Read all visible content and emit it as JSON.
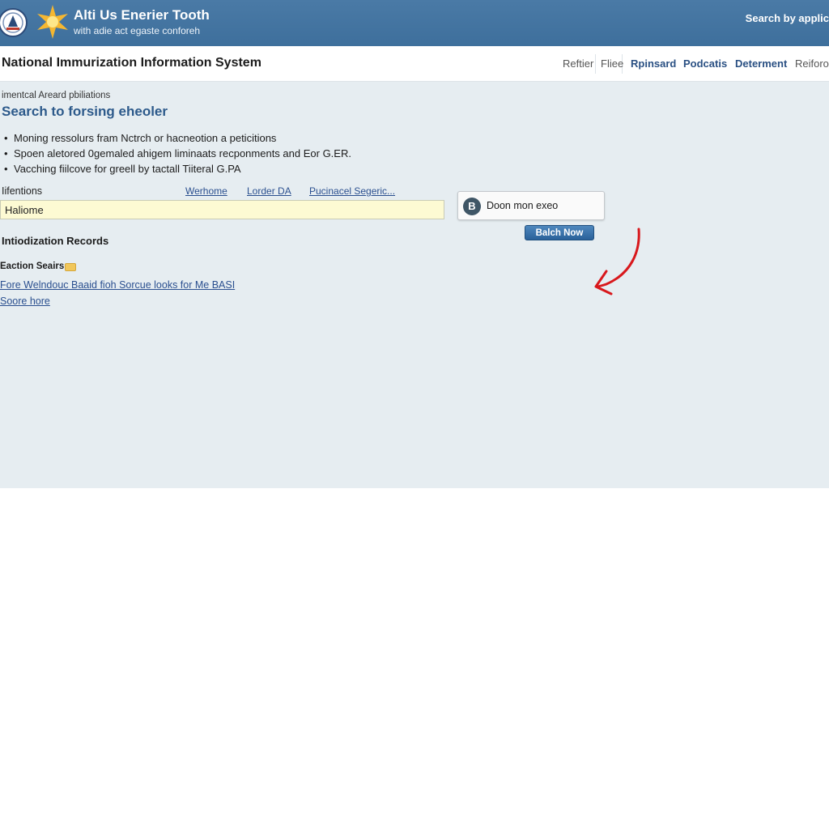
{
  "header": {
    "brand_title": "Alti Us Enerier Tooth",
    "brand_subtitle": "with adie act egaste conforeh",
    "search_link": "Search by applic"
  },
  "titlebar": {
    "site_title": "National Immurization Information System",
    "nav": [
      "Reftier",
      "Fliee",
      "Rpinsard",
      "Podcatis",
      "Determent",
      "Reiforo"
    ]
  },
  "main": {
    "breadcrumb": "imentcal Areard pbiliations",
    "heading": "Search to forsing eheoler",
    "bullets": [
      "Moning ressolurs fram Nctrch or hacneotion a peticitions",
      "Spoen aletored 0gemaled ahigem liminaats recponments and Eor G.ER.",
      "Vacching fiilcove for greell by tactall Tiiteral G.PA"
    ],
    "field_label": "Iifentions",
    "header_links": [
      "Werhome",
      "Lorder DA",
      "Pucinacel Segeric..."
    ],
    "search_value": "Haliome",
    "dropdown": {
      "icon_letter": "B",
      "label": "Doon mon exeo"
    },
    "button_label": "Balch Now",
    "section_title": "Intiodization Records",
    "sub_label": "Eaction Seairs",
    "links": [
      "Fore Welndouc Baaid fioh Sorcue looks for Me BASI",
      "Soore hore"
    ]
  },
  "colors": {
    "banner": "#3e6f9c",
    "heading": "#2d5a8b",
    "link": "#2a4f8f",
    "input_bg": "#fdfad3",
    "annotation_arrow": "#d8181c",
    "content_bg": "#e6edf1"
  }
}
